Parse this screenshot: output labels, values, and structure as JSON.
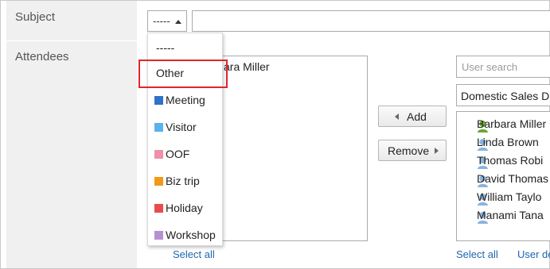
{
  "form": {
    "subject_label": "Subject",
    "attendees_label": "Attendees",
    "type_selected": "-----",
    "subject_value": ""
  },
  "attendees": {
    "selected_list": [
      "ara Miller"
    ],
    "select_all_label": "Select all"
  },
  "buttons": {
    "add_label": "Add",
    "remove_label": "Remove"
  },
  "user_panel": {
    "search_placeholder": "User search",
    "group_value": "Domestic Sales D",
    "users": [
      {
        "name": "Barbara Miller",
        "icon": "user-icon",
        "color": "#6aa82f"
      },
      {
        "name": "Linda Brown",
        "icon": "user-icon",
        "color": "#8ab4dc"
      },
      {
        "name": "Thomas Robi",
        "icon": "user-icon",
        "color": "#8ab4dc"
      },
      {
        "name": "David Thomas",
        "icon": "user-icon",
        "color": "#8ab4dc"
      },
      {
        "name": "William Taylo",
        "icon": "user-icon",
        "color": "#8ab4dc"
      },
      {
        "name": "Manami Tana",
        "icon": "user-icon",
        "color": "#8ab4dc"
      }
    ],
    "select_all_label": "Select all",
    "user_details_label": "User de"
  },
  "dropdown": {
    "items": [
      {
        "label": "-----",
        "color": null
      },
      {
        "label": "Other",
        "color": null
      },
      {
        "label": "Meeting",
        "color": "#2f73c9"
      },
      {
        "label": "Visitor",
        "color": "#5ab3ea"
      },
      {
        "label": "OOF",
        "color": "#f08fa8"
      },
      {
        "label": "Biz trip",
        "color": "#f19a16"
      },
      {
        "label": "Holiday",
        "color": "#ea4b4b"
      },
      {
        "label": "Workshop",
        "color": "#b491d1"
      }
    ],
    "highlighted_index": 1,
    "highlight_color": "#e0262b"
  }
}
